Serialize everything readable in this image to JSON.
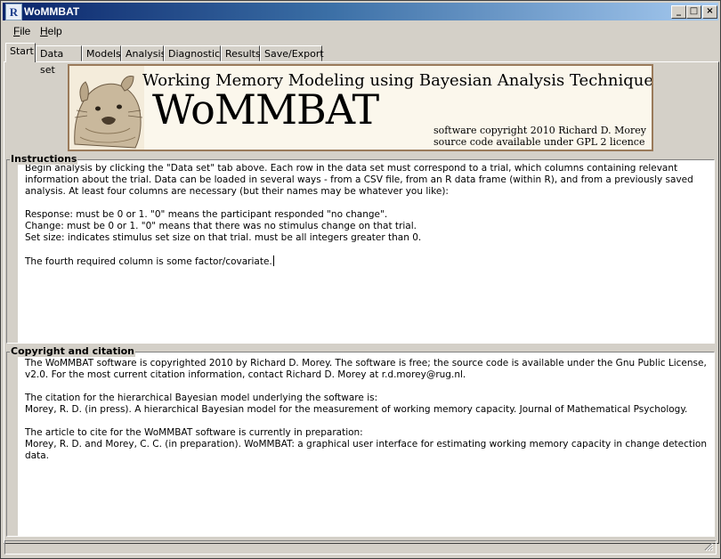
{
  "window": {
    "title": "WoMMBAT",
    "app_icon": "R"
  },
  "controls": {
    "minimize": "_",
    "maximize": "□",
    "close": "×"
  },
  "menu": {
    "items": [
      {
        "first": "F",
        "rest": "ile"
      },
      {
        "first": "H",
        "rest": "elp"
      }
    ]
  },
  "tabs": [
    "Start",
    "Data set",
    "Models",
    "Analysis",
    "Diagnostics",
    "Results",
    "Save/Export"
  ],
  "banner": {
    "subtitle": "Working Memory Modeling using Bayesian Analysis Techniques",
    "title": "WoMMBAT",
    "copyright_line1": "software copyright 2010 Richard D. Morey",
    "copyright_line2": "source code available under GPL 2 licence"
  },
  "instructions": {
    "label": "Instructions",
    "p1": "Begin analysis by clicking the \"Data set\" tab above. Each row in the data set must correspond to a trial, which columns containing relevant information about the trial. Data can be loaded in several ways - from a CSV file, from an R data frame (within R), and from a previously saved analysis. At least four columns are necessary (but their names may be whatever you like):",
    "l1": "Response: must be 0 or 1. \"0\" means the participant responded \"no change\".",
    "l2": "Change: must be 0 or 1. \"0\" means that there was no stimulus change on that trial.",
    "l3": "Set size: indicates stimulus set size on that trial. must be all integers greater than 0.",
    "l4": "The fourth required column is some factor/covariate."
  },
  "copyright": {
    "label": "Copyright and citation",
    "p1": "The WoMMBAT software is copyrighted 2010 by Richard D. Morey. The software is free; the source code is available under the Gnu Public License, v2.0. For the most current citation information, contact Richard D. Morey at r.d.morey@rug.nl.",
    "p2a": "The citation for the hierarchical Bayesian model underlying the software is:",
    "p2b": "Morey, R. D. (in press). A hierarchical Bayesian model for the measurement of working memory capacity. Journal of Mathematical Psychology.",
    "p3a": "The article to cite for the WoMMBAT software is currently in preparation:",
    "p3b": "Morey, R. D. and Morey, C. C. (in preparation). WoMMBAT: a graphical user interface for estimating working memory capacity in change detection data."
  }
}
